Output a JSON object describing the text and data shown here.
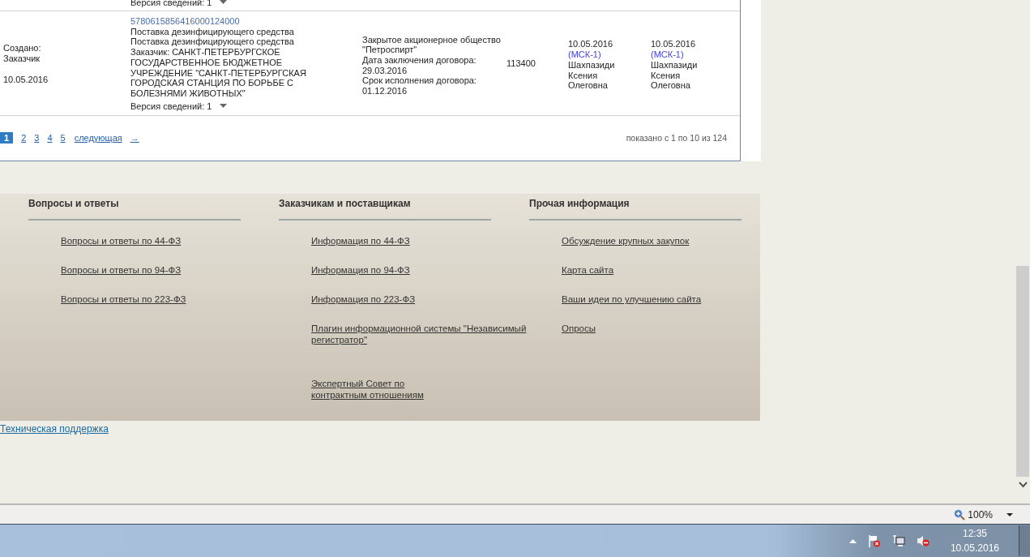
{
  "previous_row": {
    "version_label": "Версия сведений: 1"
  },
  "row": {
    "status_label": "Создано:",
    "status_value": "Заказчик",
    "created": "10.05.2016",
    "number": "5780615856416000124000",
    "subject_lines": [
      "Поставка дезинфицирующего средства",
      "Поставка дезинфицирующего средства"
    ],
    "customer": "Заказчик: САНКТ-ПЕТЕРБУРГСКОЕ ГОСУДАРСТВЕННОЕ БЮДЖЕТНОЕ УЧРЕЖДЕНИЕ \"САНКТ-ПЕТЕРБУРГСКАЯ ГОРОДСКАЯ СТАНЦИЯ ПО БОРЬБЕ С БОЛЕЗНЯМИ ЖИВОТНЫХ\"",
    "version_label": "Версия сведений: 1",
    "supplier": [
      "Закрытое акционерное общество \"Петроспирт\"",
      "Дата заключения договора:",
      "29.03.2016",
      "Срок исполнения договора:",
      "01.12.2016"
    ],
    "price": "113400",
    "events": [
      {
        "date": "10.05.2016",
        "zone": "(МСК-1)",
        "person": "Шахпазиди Ксения Олеговна"
      },
      {
        "date": "10.05.2016",
        "zone": "(МСК-1)",
        "person": "Шахпазиди Ксения Олеговна"
      }
    ]
  },
  "pagination": {
    "pages": [
      {
        "label": "1",
        "selected": true
      },
      {
        "label": "2",
        "selected": false
      },
      {
        "label": "3",
        "selected": false
      },
      {
        "label": "4",
        "selected": false
      },
      {
        "label": "5",
        "selected": false
      }
    ],
    "next": "следующая",
    "arrow": "→",
    "summary": "показано с 1 по 10 из 124"
  },
  "footer": {
    "columns": [
      {
        "title": "Вопросы и ответы",
        "links": [
          "Вопросы и ответы по 44-ФЗ",
          "Вопросы и ответы по 94-ФЗ",
          "Вопросы и ответы по 223-ФЗ"
        ]
      },
      {
        "title": "Заказчикам и поставщикам",
        "links": [
          "Информация по 44-ФЗ",
          "Информация по 94-ФЗ",
          "Информация по 223-ФЗ",
          "Плагин информационной системы \"Независимый регистратор\"",
          "Экспертный Совет по контрактным отношениям"
        ]
      },
      {
        "title": "Прочая информация",
        "links": [
          "Обсуждение крупных закупок",
          "Карта сайта",
          "Ваши идеи по улучшению сайта",
          "Опросы"
        ]
      }
    ],
    "support_link": "Техническая поддержка"
  },
  "status_bar": {
    "zoom": "100%"
  },
  "taskbar": {
    "time": "12:35",
    "date": "10.05.2016"
  }
}
